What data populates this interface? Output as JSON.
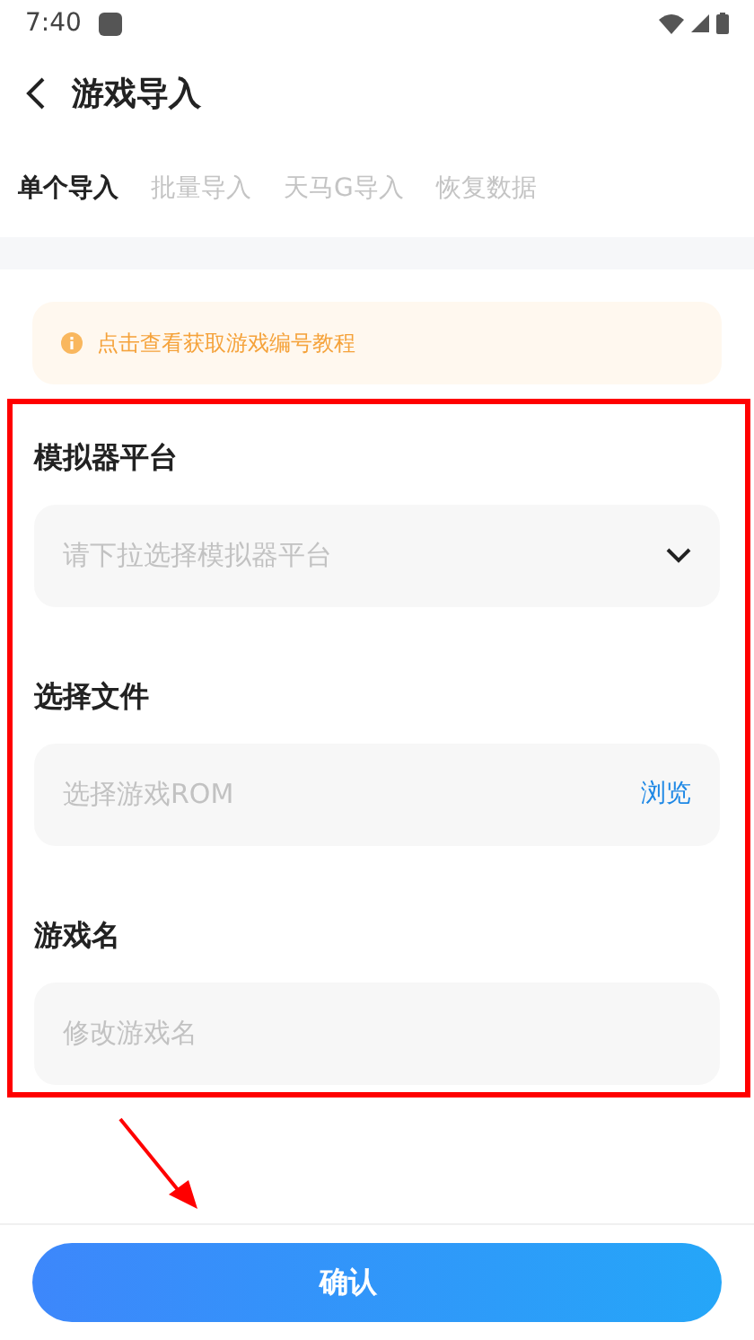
{
  "status_bar": {
    "time": "7:40"
  },
  "header": {
    "title": "游戏导入"
  },
  "tabs": [
    {
      "label": "单个导入",
      "selected": true
    },
    {
      "label": "批量导入",
      "selected": false
    },
    {
      "label": "天马G导入",
      "selected": false
    },
    {
      "label": "恢复数据",
      "selected": false
    }
  ],
  "notice": {
    "text": "点击查看获取游戏编号教程"
  },
  "form": [
    {
      "kind": "select",
      "label": "模拟器平台",
      "placeholder": "请下拉选择模拟器平台"
    },
    {
      "kind": "file",
      "label": "选择文件",
      "placeholder": "选择游戏ROM",
      "action": "浏览"
    },
    {
      "kind": "text",
      "label": "游戏名",
      "placeholder": "修改游戏名"
    }
  ],
  "confirm_button": {
    "label": "确认"
  }
}
